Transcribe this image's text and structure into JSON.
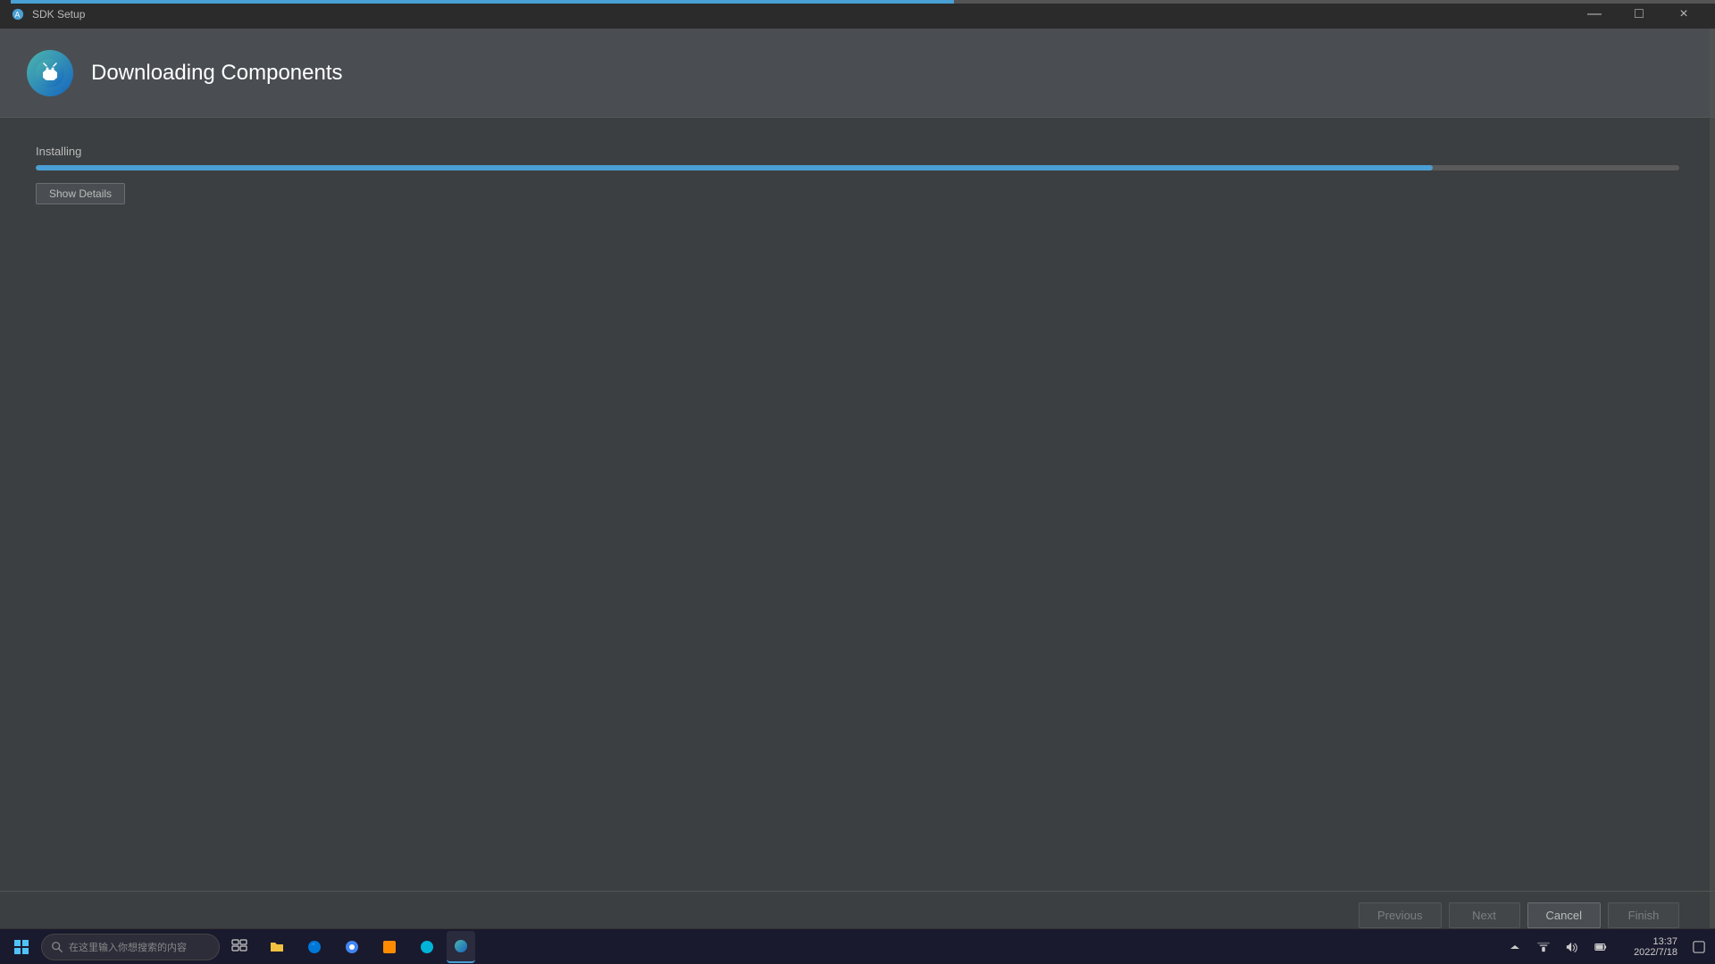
{
  "window": {
    "title": "SDK Setup",
    "close_label": "×",
    "minimize_label": "—",
    "maximize_label": "□"
  },
  "header": {
    "title": "Downloading Components",
    "logo_alt": "Android Studio Logo"
  },
  "progress": {
    "top_fill_percent": 55,
    "main_fill_percent": 85,
    "status_label": "Installing"
  },
  "buttons": {
    "show_details": "Show Details",
    "previous": "Previous",
    "next": "Next",
    "cancel": "Cancel",
    "finish": "Finish"
  },
  "taskbar": {
    "search_placeholder": "在这里输入你想搜索的内容",
    "time": "13:37",
    "date": "2022/7/18",
    "apps": []
  }
}
